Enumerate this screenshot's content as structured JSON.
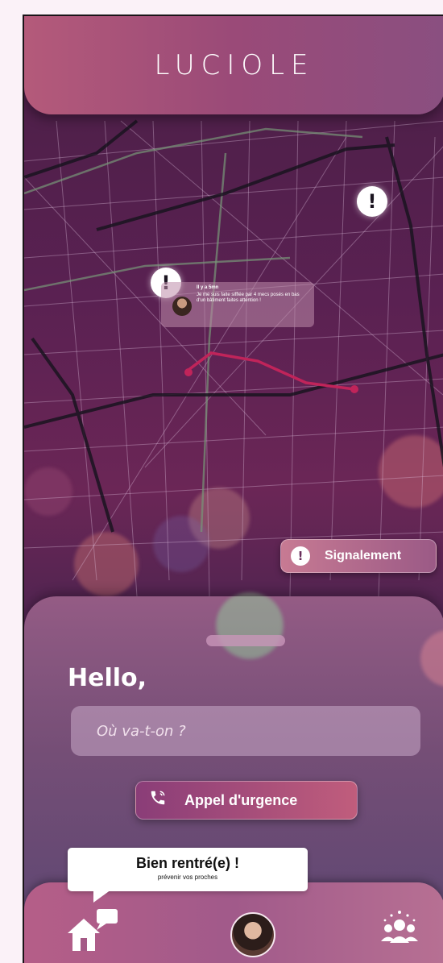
{
  "app": {
    "logo_text": "LUCIOLE"
  },
  "map": {
    "markers": [
      {
        "icon": "exclamation-icon",
        "symbol": "!"
      },
      {
        "icon": "exclamation-icon",
        "symbol": "!"
      }
    ],
    "alert_card": {
      "time": "Il y a 5mn",
      "text": "Je me suis faite sifflée par 4 mecs posés en bas d'un bâtiment faites attention !"
    }
  },
  "report_button": {
    "icon": "exclamation-icon",
    "symbol": "!",
    "label": "Signalement"
  },
  "sheet": {
    "greeting": "Hello,",
    "search_placeholder": "Où va-t-on ?",
    "emergency_button": {
      "icon": "phone-icon",
      "label": "Appel d'urgence"
    }
  },
  "tooltip": {
    "title": "Bien rentré(e) !",
    "subtitle": "prévenir vos proches"
  },
  "nav": {
    "items": [
      {
        "name": "home",
        "icon": "home-icon"
      },
      {
        "name": "profile",
        "icon": "avatar"
      },
      {
        "name": "community",
        "icon": "people-icon"
      }
    ]
  },
  "colors": {
    "header": "#b45a7a",
    "route": "#c0245a",
    "accent": "#c05d7c",
    "page_bg": "#fbf2f8"
  }
}
